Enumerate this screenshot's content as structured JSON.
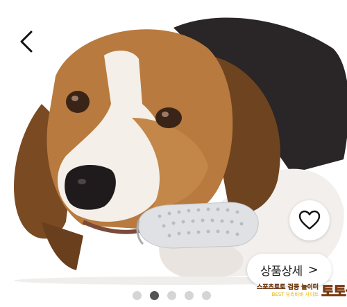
{
  "product": {
    "detail_button_label": "상품상세",
    "detail_chevron": ">"
  },
  "icons": {
    "back": "chevron-left-icon",
    "wishlist": "heart-outline-icon"
  },
  "carousel": {
    "total": 5,
    "active_index": 1
  },
  "watermark": {
    "line1": "스포츠토토 검증 놀이터",
    "line2": "BEST 유리바바 사이트",
    "big_text": "토토군"
  },
  "colors": {
    "dot_active": "#555555",
    "dot_inactive": "#d5d5d5",
    "watermark_yellow": "#f5c000"
  }
}
